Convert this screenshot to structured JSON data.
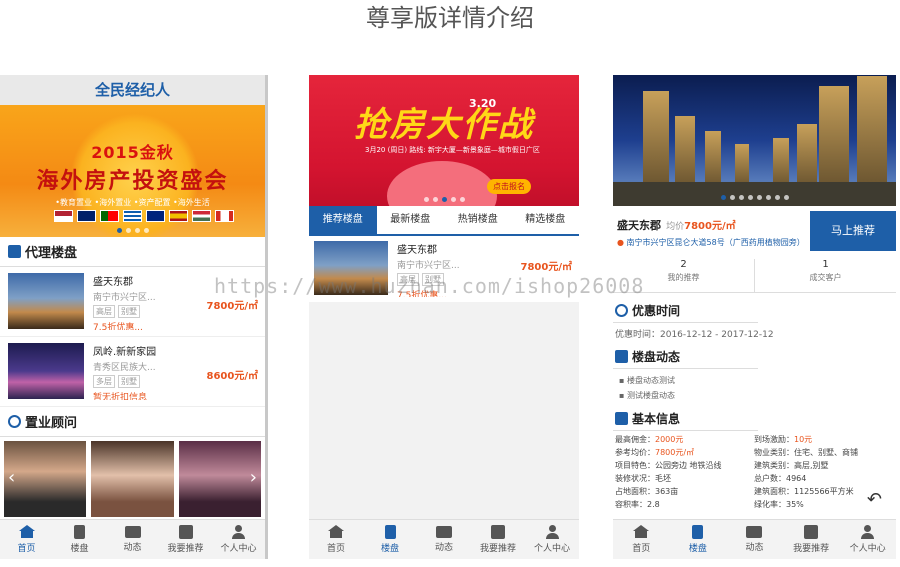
{
  "page_title": "尊享版详情介绍",
  "watermark": "https://www.huzhan.com/ishop26008",
  "colors": {
    "brand": "#1e5fa8",
    "price": "#e8541e",
    "tabbar": "#f3f3f3"
  },
  "phone1": {
    "header": "全民经纪人",
    "banner": {
      "line1": "2015金秋",
      "line2": "海外房产投资盛会",
      "line3": "•教育置业 •海外置业 •资产配置 •海外生活"
    },
    "section_agency": "代理楼盘",
    "properties": [
      {
        "name": "盛天东郡",
        "addr": "南宁市兴宁区...",
        "tags": [
          "高层",
          "别墅"
        ],
        "promo": "7.5折优惠...",
        "price": "7800元/㎡"
      },
      {
        "name": "凤岭.新新家园",
        "addr": "青秀区民族大...",
        "tags": [
          "多层",
          "别墅"
        ],
        "promo": "暂无折扣信息",
        "price": "8600元/㎡"
      }
    ],
    "section_advisor": "置业顾问"
  },
  "phone2": {
    "banner": {
      "title": "抢房大作战",
      "badge": "3.20",
      "date_line": "3月20 (周日) 路线: 新宇大厦—新景象庭—城市假日广区",
      "button": "点击报名"
    },
    "tabs": [
      "推荐楼盘",
      "最新楼盘",
      "热销楼盘",
      "精选楼盘"
    ],
    "property": {
      "name": "盛天东郡",
      "addr": "南宁市兴宁区...",
      "tags": [
        "高层",
        "别墅"
      ],
      "promo": "7.5折优惠...",
      "price": "7800元/㎡"
    }
  },
  "phone3": {
    "name": "盛天东郡",
    "avg_label": "均价",
    "avg_price": "7800元/㎡",
    "address": "南宁市兴宁区昆仑大道58号（广西药用植物园旁）",
    "recommend_button": "马上推荐",
    "stats": [
      {
        "n": "2",
        "label": "我的推荐"
      },
      {
        "n": "1",
        "label": "成交客户"
      }
    ],
    "section_discount": "优惠时间",
    "discount_time": "优惠时间：2016-12-12 - 2017-12-12",
    "section_news": "楼盘动态",
    "news": [
      "楼盘动态测试",
      "测试楼盘动态"
    ],
    "section_info": "基本信息",
    "info": [
      {
        "label": "最高佣金：",
        "value": "2000元",
        "hl": true
      },
      {
        "label": "到场激励：",
        "value": "10元",
        "hl": true
      },
      {
        "label": "参考均价：",
        "value": "7800元/㎡",
        "hl": true
      },
      {
        "label": "物业类别：",
        "value": "住宅、别墅、商铺",
        "hl": false
      },
      {
        "label": "项目特色：",
        "value": "公园旁边 地铁沿线",
        "hl": false
      },
      {
        "label": "建筑类别：",
        "value": "高层,别墅",
        "hl": false
      },
      {
        "label": "装修状况：",
        "value": "毛坯",
        "hl": false
      },
      {
        "label": "总户数：",
        "value": "4964",
        "hl": false
      },
      {
        "label": "占地面积：",
        "value": "363亩",
        "hl": false
      },
      {
        "label": "建筑面积：",
        "value": "1125566平方米",
        "hl": false
      },
      {
        "label": "容积率：",
        "value": "2.8",
        "hl": false
      },
      {
        "label": "绿化率：",
        "value": "35%",
        "hl": false
      }
    ]
  },
  "tabbar": [
    "首页",
    "楼盘",
    "动态",
    "我要推荐",
    "个人中心"
  ]
}
